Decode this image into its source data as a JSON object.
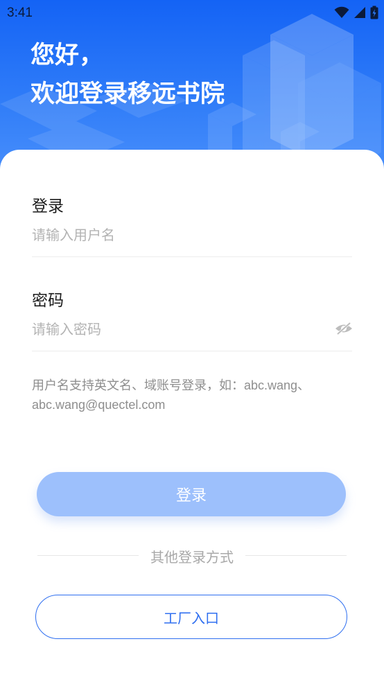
{
  "status_bar": {
    "time": "3:41",
    "icons": [
      "wifi-icon",
      "cellular-signal-icon",
      "battery-icon"
    ]
  },
  "header": {
    "greeting_line1": "您好，",
    "greeting_line2": "欢迎登录移远书院"
  },
  "form": {
    "username": {
      "label": "登录",
      "placeholder": "请输入用户名",
      "value": ""
    },
    "password": {
      "label": "密码",
      "placeholder": "请输入密码",
      "value": "",
      "toggle_icon": "eye-off-icon"
    },
    "hint": "用户名支持英文名、域账号登录，如：abc.wang、abc.wang@quectel.com"
  },
  "actions": {
    "login_label": "登录",
    "other_methods_label": "其他登录方式",
    "factory_label": "工厂入口"
  },
  "colors": {
    "brand_blue": "#1463f5",
    "login_button_disabled": "#9dc0fc",
    "factory_outline": "#2f6ff0"
  }
}
